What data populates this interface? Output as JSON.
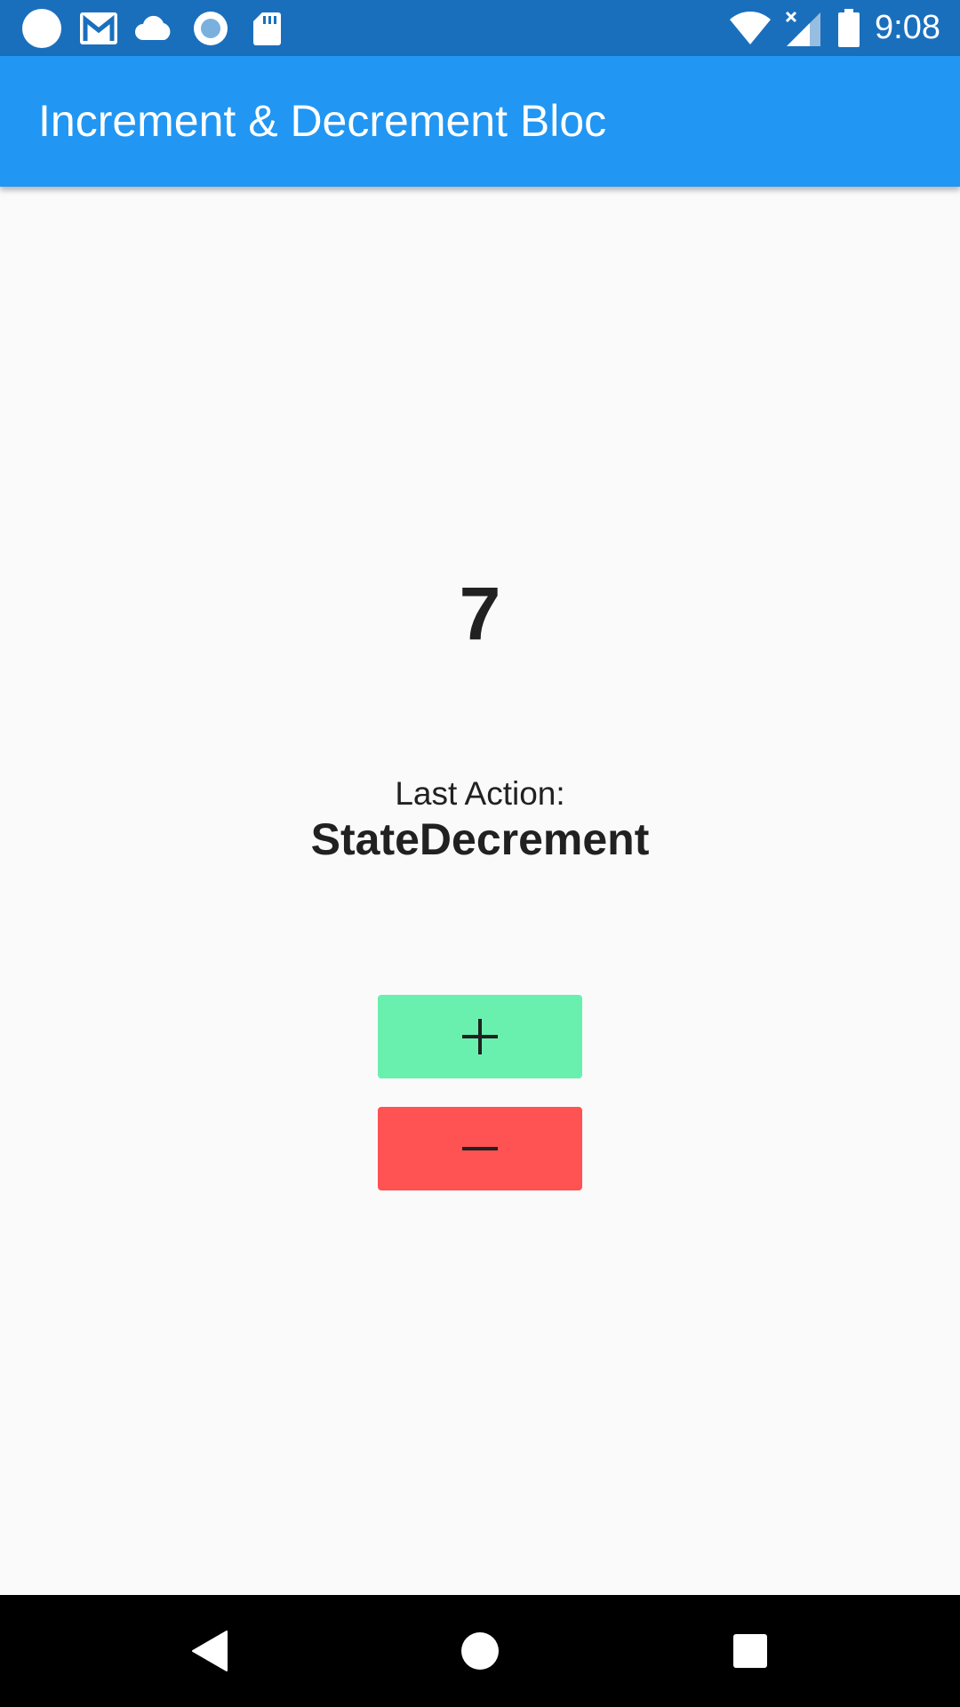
{
  "status_bar": {
    "time": "9:08",
    "left_icons": [
      "notification-dot-icon",
      "gmail-icon",
      "cloud-icon",
      "radio-icon",
      "sd-card-icon"
    ],
    "right_icons": [
      "wifi-icon",
      "cell-signal-icon",
      "battery-icon"
    ],
    "background": "#1a6fbd"
  },
  "app_bar": {
    "title": "Increment & Decrement Bloc",
    "background": "#2196f3"
  },
  "main": {
    "counter_value": "7",
    "last_action_label": "Last Action:",
    "last_action_value": "StateDecrement"
  },
  "buttons": {
    "increment": {
      "label": "+",
      "color": "#69f0ae"
    },
    "decrement": {
      "label": "−",
      "color": "#ff5252"
    }
  },
  "nav_bar": {
    "items": [
      "back-icon",
      "home-icon",
      "recents-icon"
    ]
  }
}
